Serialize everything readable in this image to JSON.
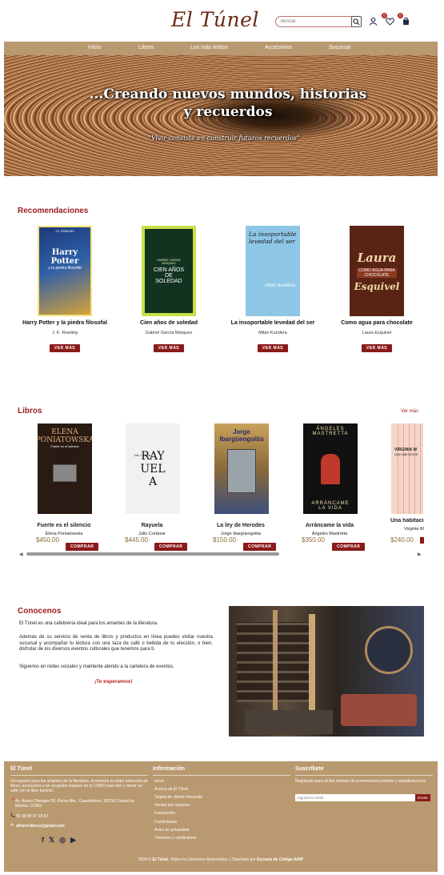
{
  "header": {
    "logo": "El Túnel",
    "search_placeholder": "Buscar",
    "wishlist_count": "0",
    "cart_count": "0"
  },
  "nav": [
    "Inicio",
    "Libros",
    "Los más leídos",
    "Accesorios",
    "Sucursal"
  ],
  "hero": {
    "title": "...Creando nuevos mundos, historias y recuerdos",
    "quote": "\"Vivir consiste en construir futuros recuerdos\""
  },
  "recomendaciones": {
    "title": "Recomendaciones",
    "button": "VER MÁS",
    "items": [
      {
        "title": "Harry Potter y la piedra filosofal",
        "author": "J. K. Rowling",
        "cover_text": "Harry Potter",
        "cover_sub": "y la piedra filosofal",
        "cover_top": "J.K. ROWLING"
      },
      {
        "title": "Cien años de soledad",
        "author": "Gabriel García Márquez",
        "cover_text": "CIEN AÑOS DE SOLEDAD",
        "cover_top": "GABRIEL GARCÍA MÁRQUEZ"
      },
      {
        "title": "La insoportable levedad del ser",
        "author": "Milan Kundera",
        "cover_text": "La insoportable levedad del ser",
        "cover_sub": "milan kundera"
      },
      {
        "title": "Como agua para chocolate",
        "author": "Laura Esquivel",
        "cover_text": "Laura",
        "cover_mid": "COMO AGUA PARA CHOCOLATE",
        "cover_sub": "Esquivel"
      }
    ]
  },
  "libros": {
    "title": "Libros",
    "ver_mas": "Ver más",
    "button": "COMPRAR",
    "items": [
      {
        "title": "Fuerte es el silencio",
        "author": "Elena Poniatowska",
        "price": "$450.00",
        "cover_text": "ELENA PONIATOWSKA",
        "cover_sub": "Fuerte es el silencio"
      },
      {
        "title": "Rayuela",
        "author": "Julio Cortázar",
        "price": "$445.00",
        "cover_text": "RAYUELA",
        "cover_top": "Julio Cortázar"
      },
      {
        "title": "La ley de Herodes",
        "author": "Jorge Ibargüengoitia",
        "price": "$150.00",
        "cover_text": "Jorge Ibargüengoitia"
      },
      {
        "title": "Arráncame la vida",
        "author": "Ángeles Mastretta",
        "price": "$350.00",
        "cover_text": "ÁNGELES MASTRETTA",
        "cover_sub": "ARRÁNCAME LA VIDA"
      },
      {
        "title": "Una habitación",
        "author": "Virginia W",
        "price": "$240.00",
        "cover_text": "VIRGINIA W",
        "cover_sub": "UNA HABITACIÓN"
      }
    ]
  },
  "conocenos": {
    "title": "Conocenos",
    "p1": "El Túnel es una cafebrería ideal para los amantes de la literatura.",
    "p2": "Además de su servicio de venta de libros y productos en línea puedes visitar nuestra sucursal y acompañar tu lectura con una taza de café o bebida de tu elección, o bien, disfrutar de los diversos eventos culturales que tenemos para ti.",
    "p3": "Siguenos en redes sociales y mantente atendo a la cartelera de eventos.",
    "cta": "¡Te esperamos!"
  },
  "footer": {
    "col1_title": "El Túnel",
    "col1_text": "Un espacio para los amantes de la literatura. Encuentra la mejor selección de libros, accesorios y un acogedor espacio en la CDMX para leer y tomar un café con tu libro favorito.",
    "address": "Av. Álvaro Obregón 95, Roma Nte., Cuauhtémoc, 06700 Ciudad de México, CDMX",
    "phone": "56 98 89 07 99 87",
    "email": "eltunel.libros@gmail.com",
    "col2_title": "Información",
    "links": [
      "Inicio",
      "Acerca de El Túnel",
      "Tarjeta de cliente frecuente",
      "Ventas por mayoreo",
      "Facturación",
      "Contáctanos",
      "Aviso de privacidad",
      "Términos y condiciones"
    ],
    "col3_title": "Suscríbete",
    "col3_text": "Regístrate para recibir noticias de promociones,eventos y actualizaciones.",
    "email_placeholder": "Ingresa tu email",
    "send": "Enviar",
    "copyright_pre": "2024 © ",
    "copyright_brand": "El Túnel",
    "copyright_mid": ". Todos los Derechos Reservados. | Diseñado por ",
    "copyright_by": "Escuela de Código ADIP"
  },
  "colors": {
    "accent": "#b9996f",
    "brand_red": "#8b1a1a",
    "title_red": "#9b1c1c",
    "logo": "#6b2a12"
  }
}
